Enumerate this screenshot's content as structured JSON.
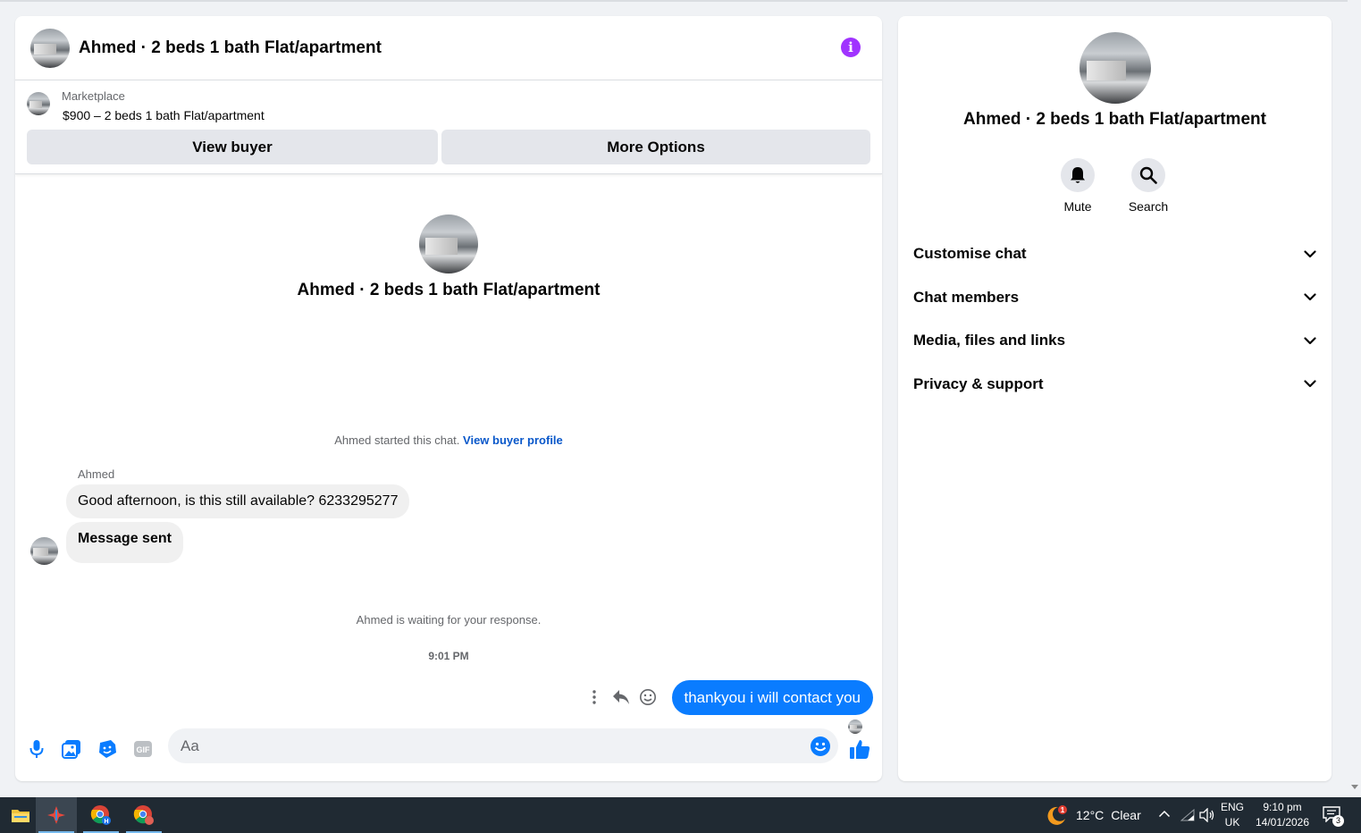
{
  "chat": {
    "title": "Ahmed · 2 beds 1 bath Flat/apartment",
    "marketplace_label": "Marketplace",
    "listing": "$900 – 2 beds 1 bath Flat/apartment",
    "view_buyer_label": "View buyer",
    "more_options_label": "More Options",
    "intro_title": "Ahmed · 2 beds 1 bath Flat/apartment",
    "started_text": "Ahmed started this chat.",
    "view_buyer_profile_link": "View buyer profile",
    "sender_name": "Ahmed",
    "messages_in": [
      "Good afternoon, is this still available? 6233295277",
      "Message sent"
    ],
    "waiting_text": "Ahmed is waiting for your response.",
    "timestamp": "9:01 PM",
    "message_out": "thankyou i will contact you",
    "composer_placeholder": "Aa",
    "accent_color": "#0a7cff"
  },
  "sidebar": {
    "title": "Ahmed · 2 beds 1 bath Flat/apartment",
    "actions": [
      {
        "label": "Mute",
        "icon": "bell-icon"
      },
      {
        "label": "Search",
        "icon": "search-icon"
      }
    ],
    "sections": [
      "Customise chat",
      "Chat members",
      "Media, files and links",
      "Privacy & support"
    ]
  },
  "taskbar": {
    "apps": [
      "file-explorer-icon",
      "app-icon",
      "chrome-profile-h-icon",
      "chrome-icon"
    ],
    "weather_temp": "12°C",
    "weather_condition": "Clear",
    "weather_badge": "1",
    "lang_top": "ENG",
    "lang_bottom": "UK",
    "time": "9:10 pm",
    "date": "14/01/2026",
    "notification_count": "3"
  }
}
